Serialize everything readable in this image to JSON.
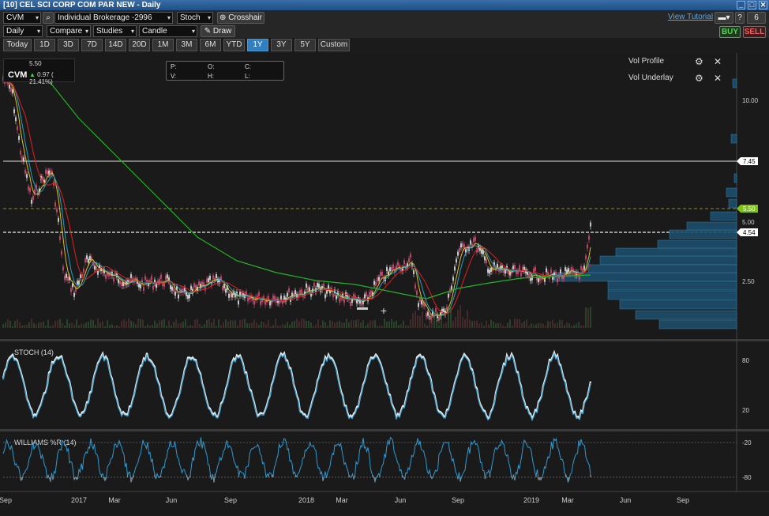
{
  "window": {
    "title": "[10] CEL SCI CORP COM PAR NEW - Daily",
    "link_count": "6"
  },
  "toolbar1": {
    "symbol": "CVM",
    "account": "Individual Brokerage -2996",
    "indicator": "Stoch",
    "crosshair": "Crosshair",
    "tutorial": "View Tutorial",
    "buy": "BUY",
    "sell": "SELL"
  },
  "toolbar2": {
    "interval": "Daily",
    "compare": "Compare",
    "studies": "Studies",
    "style": "Candle",
    "draw": "Draw"
  },
  "ranges": [
    "Today",
    "1D",
    "3D",
    "7D",
    "14D",
    "20D",
    "1M",
    "3M",
    "6M",
    "YTD",
    "1Y",
    "3Y",
    "5Y",
    "Custom"
  ],
  "active_range": "1Y",
  "legend": {
    "symbol": "CVM",
    "price": "5.50",
    "change": "0.97 ( 21.41%)"
  },
  "ohlc": {
    "p": "P:",
    "o": "O:",
    "c": "C:",
    "v": "V:",
    "h": "H:",
    "l": "L:"
  },
  "overlays": [
    {
      "name": "Vol Profile"
    },
    {
      "name": "Vol Underlay"
    }
  ],
  "price_axis": {
    "ticks": [
      "10.00",
      "5.00",
      "2.50"
    ],
    "tags": [
      {
        "value": "7.45",
        "color": "#ffffff"
      },
      {
        "value": "5.50",
        "color": "#7cc217"
      },
      {
        "value": "4.54",
        "color": "#ffffff"
      }
    ]
  },
  "stoch": {
    "label": "STOCH (14)",
    "ticks": [
      "80",
      "20"
    ]
  },
  "williams": {
    "label": "WILLIAMS %R (14)",
    "ticks": [
      "-20",
      "-80"
    ]
  },
  "x_axis": [
    "Sep",
    "2017",
    "Mar",
    "Jun",
    "Sep",
    "2018",
    "Mar",
    "Jun",
    "Sep",
    "2019",
    "Mar",
    "Jun",
    "Sep"
  ],
  "colors": {
    "accent": "#2f7fc1",
    "buy": "#3fb33f",
    "sell": "#e03b3b",
    "ma_slow": "#22b422",
    "ma_mid": "#d21e1e",
    "ma_fast": "#e0c21a",
    "ma_fast2": "#22a0c8",
    "volprofile": "#1d4e6b"
  }
}
